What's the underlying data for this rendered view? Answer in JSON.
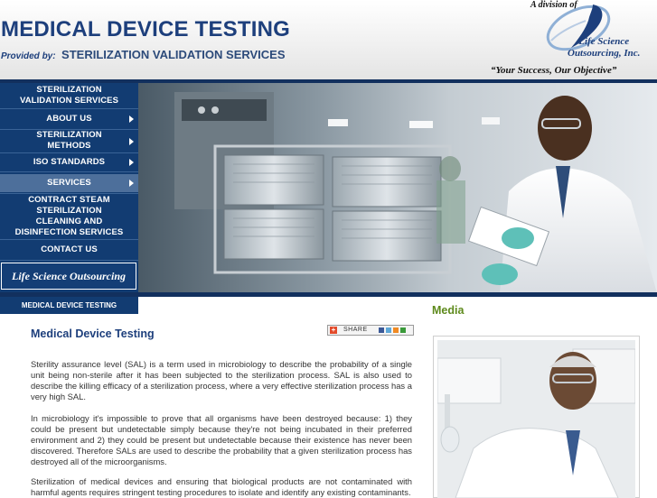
{
  "header": {
    "title": "MEDICAL DEVICE TESTING",
    "provided_by_prefix": "Provided by:",
    "provided_by_name": "STERILIZATION VALIDATION SERVICES",
    "division_text": "A division of",
    "logo_line1": "Life Science",
    "logo_line2": "Outsourcing, Inc.",
    "tagline": "“Your Success, Our Objective”"
  },
  "nav": {
    "items": [
      {
        "line1": "STERILIZATION",
        "line2": "VALIDATION SERVICES"
      },
      {
        "line1": "ABOUT US"
      },
      {
        "line1": "STERILIZATION",
        "line2": "METHODS"
      },
      {
        "line1": "ISO STANDARDS"
      },
      {
        "line1": "SERVICES"
      },
      {
        "line1": "CONTRACT STEAM",
        "line2": "STERILIZATION"
      },
      {
        "line1": "CLEANING AND",
        "line2": "DISINFECTION SERVICES"
      },
      {
        "line1": "CONTACT US"
      }
    ],
    "lso_label": "Life Science Outsourcing"
  },
  "breadcrumb": "MEDICAL DEVICE TESTING",
  "content": {
    "title": "Medical Device Testing",
    "share_label": "SHARE",
    "paragraphs": [
      "Sterility assurance level (SAL) is a term used in microbiology to describe the probability of a single unit being non-sterile after it has been subjected to the sterilization process. SAL is also used to describe the killing efficacy of a sterilization process, where a very effective sterilization process has a very high SAL.",
      "In microbiology it's impossible to prove that all organisms have been destroyed because: 1) they could be present but undetectable simply because they're not being incubated in their preferred environment and 2) they could be present but undetectable because their existence has never been discovered. Therefore SALs are used to describe the probability that a given sterilization process has destroyed all of the microorganisms.",
      "Sterilization of medical devices and ensuring that biological products are not contaminated with harmful agents requires stringent testing procedures to isolate and identify any existing contaminants."
    ]
  },
  "media": {
    "title": "Media"
  },
  "colors": {
    "navy": "#123c72",
    "title_blue": "#1d3f7c",
    "media_green": "#5e8a1c",
    "nav_active": "#4d6f9b"
  }
}
